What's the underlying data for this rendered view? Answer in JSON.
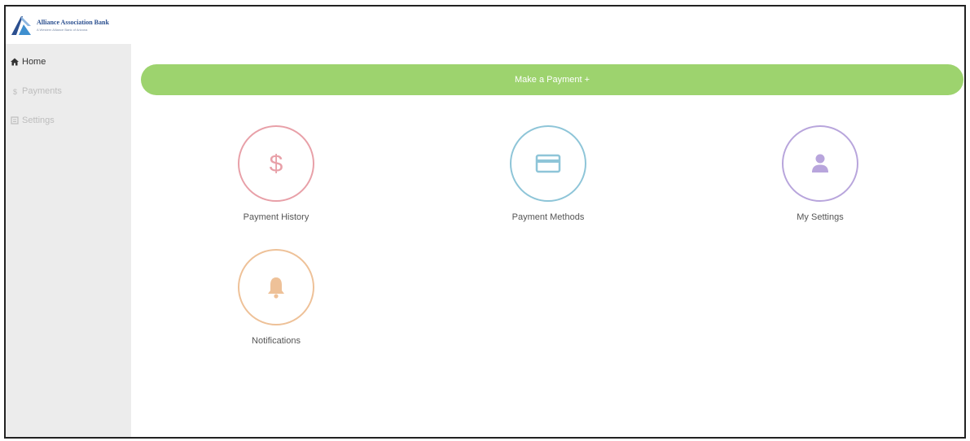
{
  "brand": {
    "name": "Alliance Association Bank",
    "tagline": "A Western Alliance Bank of Arizona"
  },
  "sidebar": {
    "items": [
      {
        "label": "Home",
        "icon": "home-icon",
        "active": true
      },
      {
        "label": "Payments",
        "icon": "payments-icon",
        "active": false
      },
      {
        "label": "Settings",
        "icon": "settings-icon",
        "active": false
      }
    ]
  },
  "main": {
    "payment_button_label": "Make a Payment +",
    "tiles": [
      {
        "label": "Payment History",
        "icon": "dollar-icon",
        "color": "#e8a0a8"
      },
      {
        "label": "Payment Methods",
        "icon": "credit-card-icon",
        "color": "#8ec5d8"
      },
      {
        "label": "My Settings",
        "icon": "user-icon",
        "color": "#b8a5dc"
      },
      {
        "label": "Notifications",
        "icon": "bell-icon",
        "color": "#eec198"
      }
    ]
  },
  "colors": {
    "accent_green": "#9dd36e",
    "sidebar_bg": "#ececec",
    "brand_blue": "#2b4f8f"
  }
}
